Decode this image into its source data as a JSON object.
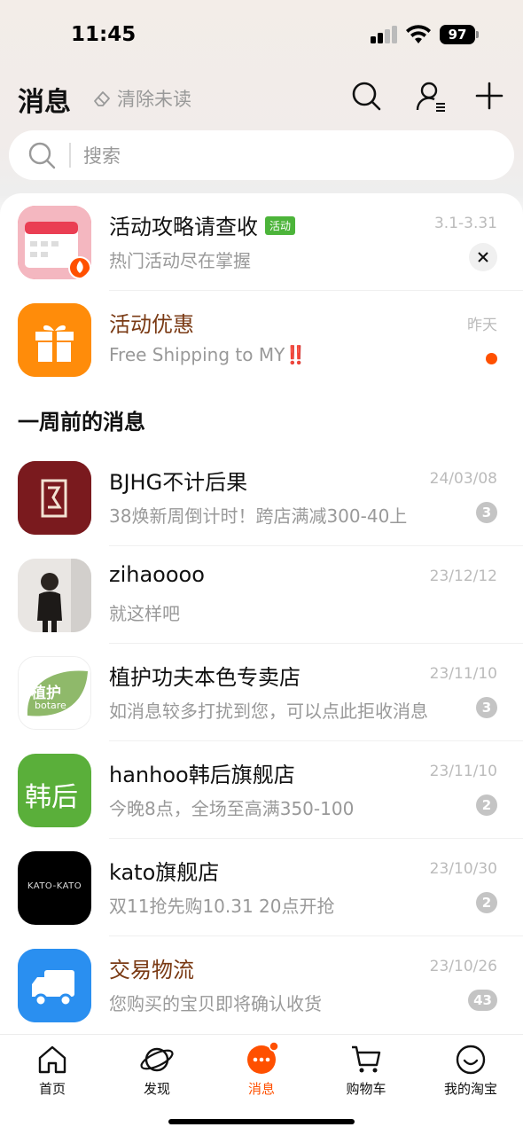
{
  "status": {
    "time": "11:45",
    "battery": "97"
  },
  "header": {
    "title": "消息",
    "clear_unread": "清除未读"
  },
  "search": {
    "placeholder": "搜索"
  },
  "pinned": [
    {
      "name": "活动攻略请查收",
      "tag": "活动",
      "subtitle": "热门活动尽在掌握",
      "time": "3.1-3.31"
    },
    {
      "name": "活动优惠",
      "subtitle": "Free Shipping to MY‼️",
      "time": "昨天"
    }
  ],
  "section_title": "一周前的消息",
  "conversations": [
    {
      "name": "BJHG不计后果",
      "subtitle": "38焕新周倒计时！跨店满减300-40上",
      "time": "24/03/08",
      "count": "3",
      "avatar_color": "#7a1a1e"
    },
    {
      "name": "zihaoooo",
      "subtitle": "就这样吧",
      "time": "23/12/12",
      "count": ""
    },
    {
      "name": "植护功夫本色专卖店",
      "subtitle": "如消息较多打扰到您，可以点此拒收消息",
      "time": "23/11/10",
      "count": "3",
      "avatar_text": "植护",
      "avatar_sub": "botare"
    },
    {
      "name": "hanhoo韩后旗舰店",
      "subtitle": "今晚8点，全场至高满350-100",
      "time": "23/11/10",
      "count": "2",
      "avatar_text": "韩后"
    },
    {
      "name": "kato旗舰店",
      "subtitle": "双11抢先购10.31 20点开抢",
      "time": "23/10/30",
      "count": "2",
      "avatar_text": "KATO-KATO"
    },
    {
      "name": "交易物流",
      "subtitle": "您购买的宝贝即将确认收货",
      "time": "23/10/26",
      "count": "43"
    }
  ],
  "tabs": [
    {
      "label": "首页",
      "icon": "home-icon"
    },
    {
      "label": "发现",
      "icon": "planet-icon"
    },
    {
      "label": "消息",
      "icon": "message-icon",
      "active": true
    },
    {
      "label": "购物车",
      "icon": "cart-icon"
    },
    {
      "label": "我的淘宝",
      "icon": "smile-icon"
    }
  ],
  "colors": {
    "accent": "#ff5000",
    "tag_green": "#4cb43a",
    "brown_title": "#7a3a14"
  }
}
